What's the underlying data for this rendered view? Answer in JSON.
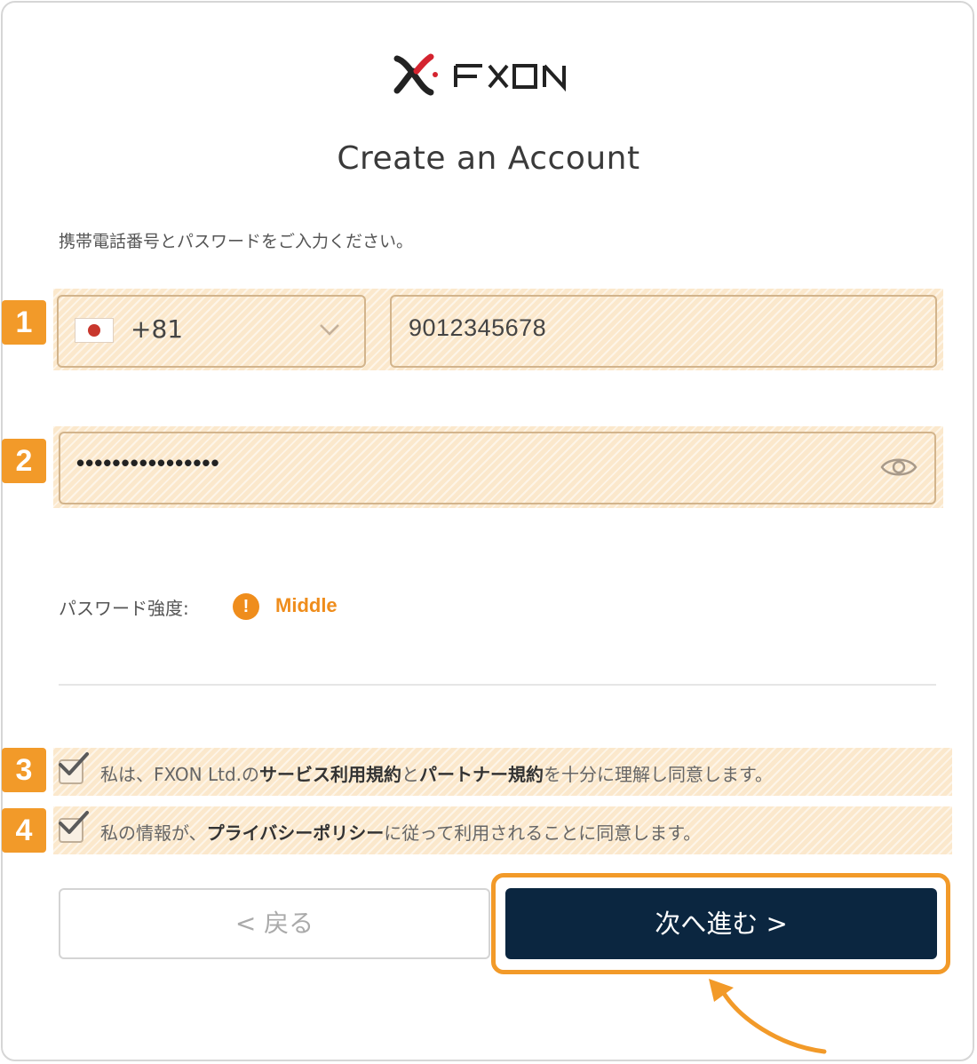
{
  "brand": {
    "name": "FXON",
    "accent": "#f29a29",
    "logo_red": "#d4232f",
    "dark": "#0b2640"
  },
  "page": {
    "title": "Create an Account",
    "instruction": "携帯電話番号とパスワードをご入力ください。"
  },
  "badges": [
    "1",
    "2",
    "3",
    "4"
  ],
  "phone": {
    "country_flag": "japan-flag",
    "country_code": "+81",
    "number": "9012345678"
  },
  "password": {
    "masked_value": "••••••••••••••••",
    "toggle_icon": "eye-icon"
  },
  "strength": {
    "label": "パスワード強度:",
    "value": "Middle",
    "color": "#ef8d1c"
  },
  "agreements": [
    {
      "checked": true,
      "prefix": "私は、FXON Ltd.の",
      "link1": "サービス利用規約",
      "middle": "と",
      "link2": "パートナー規約",
      "suffix": "を十分に理解し同意します。"
    },
    {
      "checked": true,
      "prefix": "私の情報が、",
      "link1": "プライバシーポリシー",
      "suffix": "に従って利用されることに同意します。"
    }
  ],
  "buttons": {
    "back": "< 戻る",
    "next": "次へ進む >"
  }
}
